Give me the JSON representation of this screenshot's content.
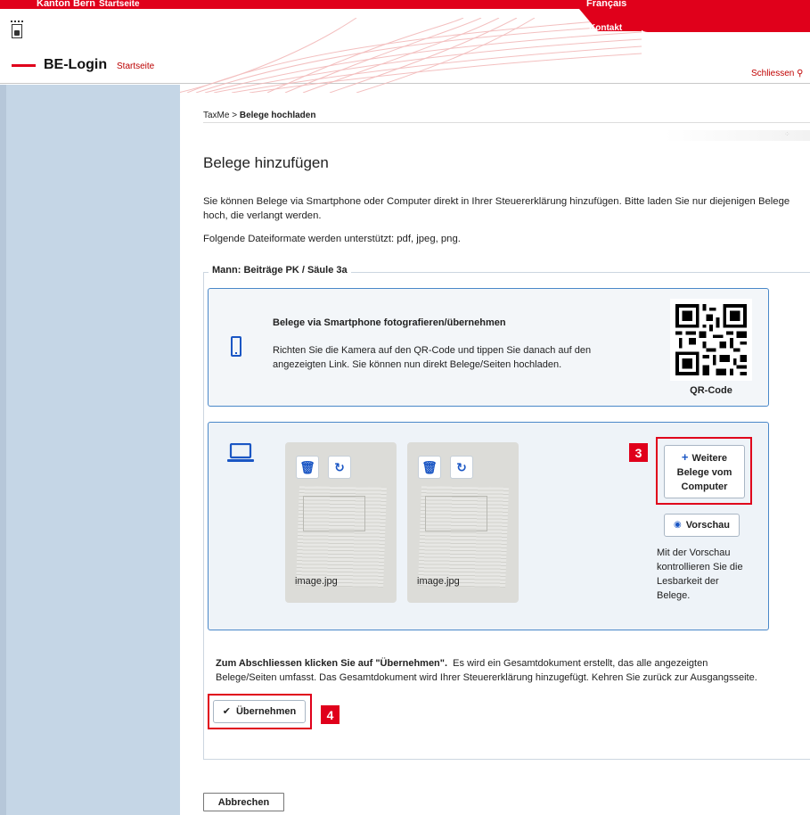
{
  "topbar": {
    "canton": "Kanton Bern",
    "startseite": "Startseite",
    "language": "Français",
    "contact": "Kontakt"
  },
  "header": {
    "app_name": "BE-Login",
    "startseite": "Startseite",
    "close_label": "Schliessen"
  },
  "breadcrumb": {
    "root": "TaxMe",
    "separator": ">",
    "current": "Belege hochladen"
  },
  "page": {
    "title": "Belege hinzufügen",
    "intro": "Sie können Belege via Smartphone oder Computer direkt in Ihrer Steuererklärung hinzufügen. Bitte laden Sie nur diejenigen Belege hoch, die verlangt werden.",
    "formats": "Folgende Dateiformate werden unterstützt: pdf, jpeg, png."
  },
  "section": {
    "legend": "Mann: Beiträge PK / Säule 3a",
    "smartphone": {
      "title": "Belege via Smartphone fotografieren/übernehmen",
      "text": "Richten Sie die Kamera auf den QR-Code und tippen Sie danach auf den angezeigten Link. Sie können nun direkt Belege/Seiten hochladen.",
      "qr_label": "QR-Code"
    },
    "computer": {
      "files": [
        {
          "name": "image.jpg"
        },
        {
          "name": "image.jpg"
        }
      ],
      "add_button": "Weitere Belege vom Computer",
      "preview_button": "Vorschau",
      "preview_text": "Mit der Vorschau kontrollieren Sie die Lesbarkeit der Belege."
    },
    "finish": {
      "bold": "Zum Abschliessen klicken Sie auf \"Übernehmen\".",
      "text": "Es wird ein Gesamtdokument erstellt, das alle angezeigten Belege/Seiten umfasst. Das Gesamtdokument wird Ihrer Steuererklärung hinzugefügt. Kehren Sie zurück zur Ausgangsseite.",
      "apply_button": "Übernehmen"
    }
  },
  "cancel_button": "Abbrechen",
  "annotations": {
    "step_add": "3",
    "step_apply": "4"
  },
  "icons": {
    "trash": "trash-icon",
    "rotate": "rotate-icon",
    "phone": "smartphone-icon",
    "laptop": "laptop-icon",
    "eye": "eye-icon",
    "check": "check-icon",
    "plus": "plus-icon"
  },
  "colors": {
    "brand_red": "#e0001b",
    "accent_blue": "#1a56c4",
    "sidebar": "#c5d6e6",
    "panel_border": "#4a88c9"
  }
}
